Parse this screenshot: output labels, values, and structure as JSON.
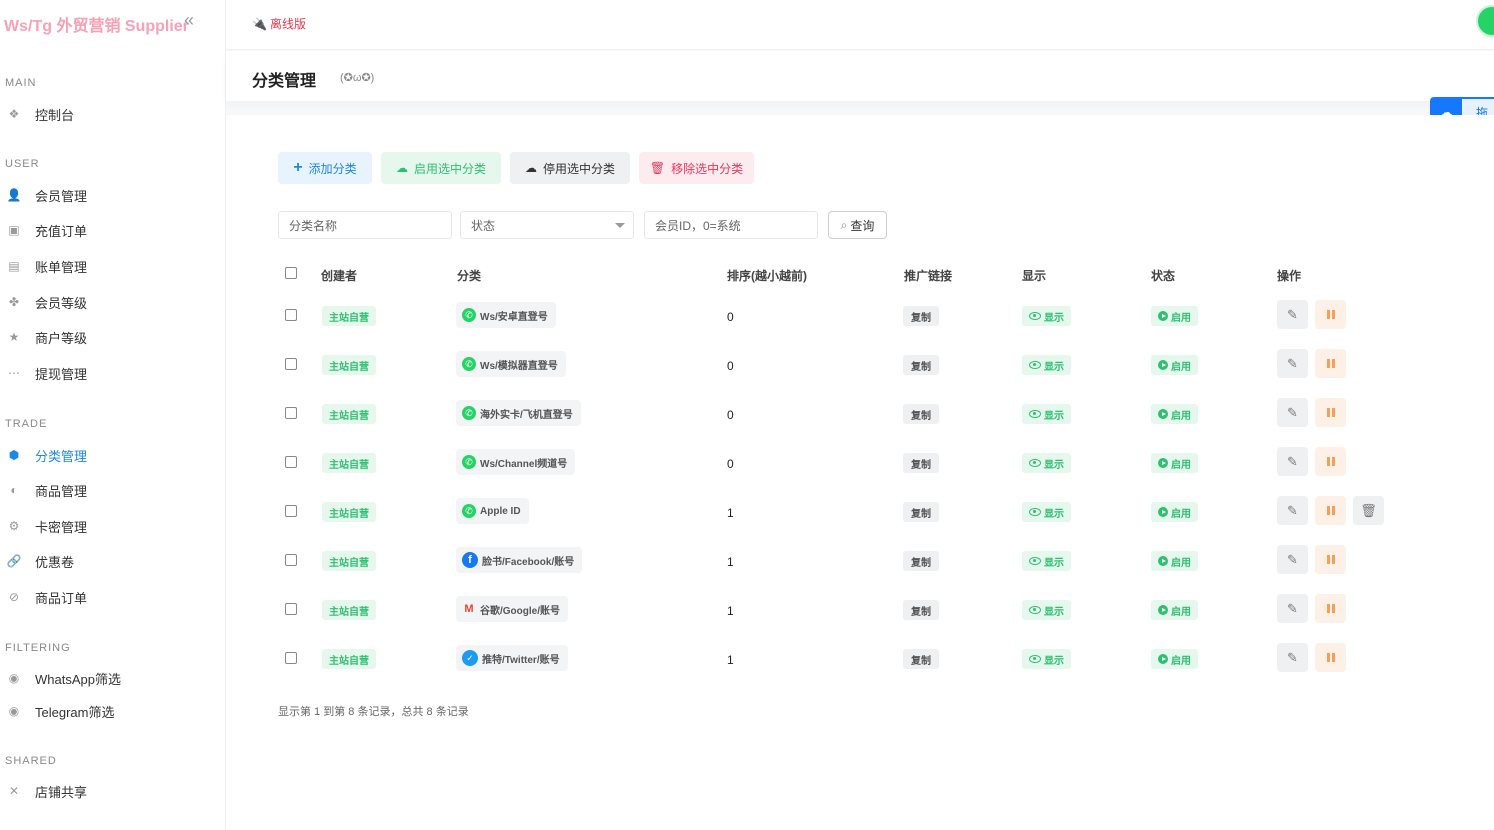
{
  "sidebar": {
    "brand": "Ws/Tg 外贸营销 Supplier",
    "collapse_icon": "«",
    "sections": {
      "main": "MAIN",
      "user": "USER",
      "trade": "TRADE",
      "filtering": "FILTERING",
      "shared": "SHARED"
    },
    "items": {
      "dashboard": "控制台",
      "members": "会员管理",
      "recharge": "充值订单",
      "bills": "账单管理",
      "member_level": "会员等级",
      "merchant_level": "商户等级",
      "withdraw": "提现管理",
      "category": "分类管理",
      "goods": "商品管理",
      "cardkey": "卡密管理",
      "coupon": "优惠卷",
      "goods_order": "商品订单",
      "whatsapp_filter": "WhatsApp筛选",
      "telegram_filter": "Telegram筛选",
      "shop_share": "店铺共享"
    }
  },
  "topbar": {
    "offline_label": "离线版"
  },
  "page": {
    "title": "分类管理",
    "emote": "(✪ω✪)"
  },
  "float_widget": {
    "tab_label": "拖"
  },
  "toolbar": {
    "add": "添加分类",
    "enable": "启用选中分类",
    "disable": "停用选中分类",
    "remove": "移除选中分类"
  },
  "filters": {
    "name_placeholder": "分类名称",
    "status_selected": "状态",
    "member_placeholder": "会员ID，0=系统",
    "query": "查询"
  },
  "table": {
    "headers": {
      "creator": "创建者",
      "category": "分类",
      "sort": "排序(越小越前)",
      "promo": "推广链接",
      "display": "显示",
      "status": "状态",
      "actions": "操作"
    },
    "rows": [
      {
        "creator": "主站自营",
        "category": "Ws/安卓直登号",
        "icon": "whatsapp-icon",
        "sort": "0",
        "promo": "复制",
        "display": "显示",
        "status": "启用"
      },
      {
        "creator": "主站自营",
        "category": "Ws/模拟器直登号",
        "icon": "whatsapp-icon",
        "sort": "0",
        "promo": "复制",
        "display": "显示",
        "status": "启用"
      },
      {
        "creator": "主站自营",
        "category": "海外实卡/飞机直登号",
        "icon": "whatsapp-icon",
        "sort": "0",
        "promo": "复制",
        "display": "显示",
        "status": "启用"
      },
      {
        "creator": "主站自营",
        "category": "Ws/Channel频道号",
        "icon": "whatsapp-icon",
        "sort": "0",
        "promo": "复制",
        "display": "显示",
        "status": "启用"
      },
      {
        "creator": "主站自营",
        "category": "Apple ID",
        "icon": "whatsapp-icon",
        "sort": "1",
        "promo": "复制",
        "display": "显示",
        "status": "启用"
      },
      {
        "creator": "主站自营",
        "category": "脸书/Facebook/账号",
        "icon": "facebook-icon",
        "sort": "1",
        "promo": "复制",
        "display": "显示",
        "status": "启用"
      },
      {
        "creator": "主站自营",
        "category": "谷歌/Google/账号",
        "icon": "gmail-icon",
        "sort": "1",
        "promo": "复制",
        "display": "显示",
        "status": "启用"
      },
      {
        "creator": "主站自营",
        "category": "推特/Twitter/账号",
        "icon": "twitter-icon",
        "sort": "1",
        "promo": "复制",
        "display": "显示",
        "status": "启用"
      }
    ]
  },
  "footer": {
    "summary": "显示第 1 到第 8 条记录，总共 8 条记录"
  },
  "colors": {
    "accent": "#1e88e5",
    "success": "#2fbf71",
    "danger": "#e5395a",
    "warning": "#f5a05a",
    "brand": "#f7a1b5"
  }
}
